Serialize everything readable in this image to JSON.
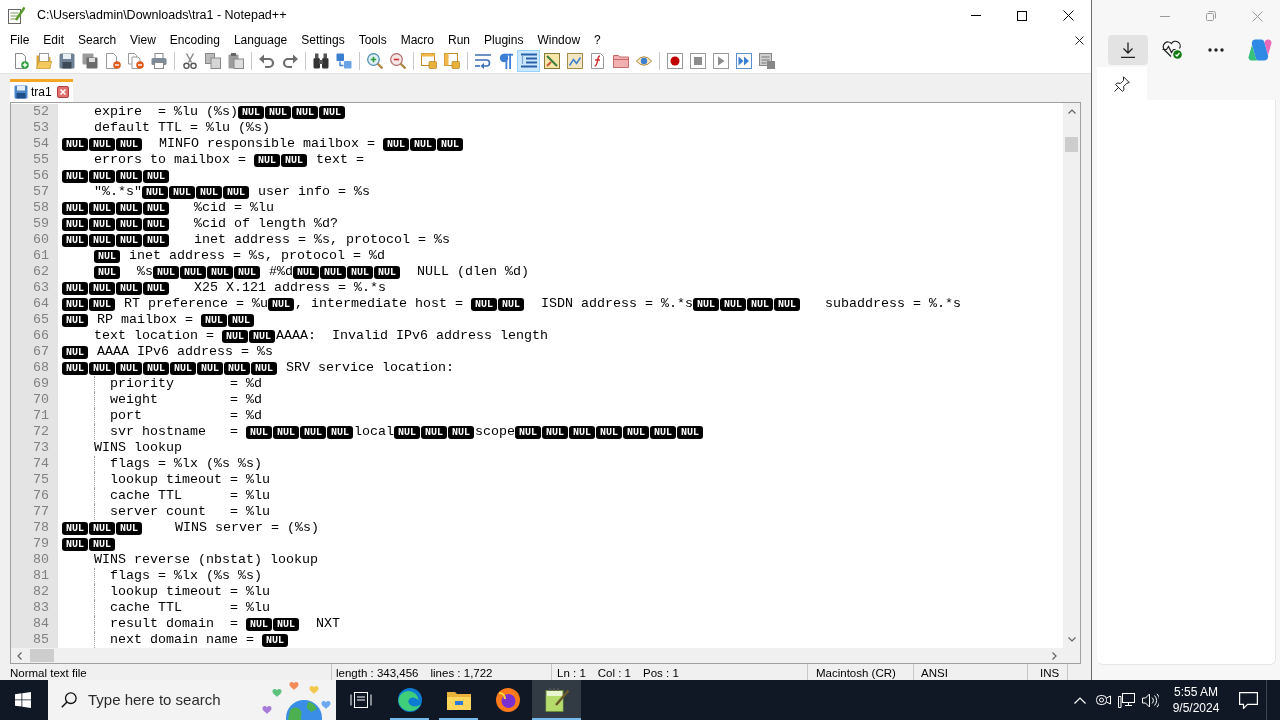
{
  "window": {
    "title": "C:\\Users\\admin\\Downloads\\tra1 - Notepad++"
  },
  "menu": [
    "File",
    "Edit",
    "Search",
    "View",
    "Encoding",
    "Language",
    "Settings",
    "Tools",
    "Macro",
    "Run",
    "Plugins",
    "Window",
    "?"
  ],
  "toolbar": [
    {
      "buttons": [
        {
          "kind": "new",
          "on": false
        },
        {
          "kind": "open",
          "on": false
        },
        {
          "kind": "save",
          "on": false
        },
        {
          "kind": "save-all",
          "on": false
        },
        {
          "kind": "close",
          "on": false
        },
        {
          "kind": "close-all",
          "on": false
        },
        {
          "kind": "print",
          "on": false
        }
      ]
    },
    {
      "buttons": [
        {
          "kind": "cut",
          "on": false
        },
        {
          "kind": "copy",
          "on": false
        },
        {
          "kind": "paste",
          "on": false
        }
      ]
    },
    {
      "buttons": [
        {
          "kind": "undo",
          "on": false
        },
        {
          "kind": "redo",
          "on": false
        }
      ]
    },
    {
      "buttons": [
        {
          "kind": "find",
          "on": false
        },
        {
          "kind": "replace",
          "on": false
        }
      ]
    },
    {
      "buttons": [
        {
          "kind": "zoom-in",
          "on": false
        },
        {
          "kind": "zoom-out",
          "on": false
        }
      ]
    },
    {
      "buttons": [
        {
          "kind": "sync-vertical",
          "on": false
        },
        {
          "kind": "sync-horizontal",
          "on": false
        }
      ]
    },
    {
      "buttons": [
        {
          "kind": "word-wrap",
          "on": false
        },
        {
          "kind": "show-all-chars",
          "on": false
        },
        {
          "kind": "indent-guide",
          "on": true
        },
        {
          "kind": "user-language",
          "on": false
        },
        {
          "kind": "document-map",
          "on": false
        },
        {
          "kind": "function-list",
          "on": false
        },
        {
          "kind": "folder-workspace",
          "on": false
        },
        {
          "kind": "monitoring",
          "on": false
        }
      ]
    },
    {
      "buttons": [
        {
          "kind": "record",
          "on": false
        },
        {
          "kind": "stop",
          "on": false
        },
        {
          "kind": "play",
          "on": false
        },
        {
          "kind": "run-multiple",
          "on": false
        },
        {
          "kind": "save-macro",
          "on": false
        }
      ]
    }
  ],
  "tabs": [
    {
      "label": "tra1",
      "selected": true
    }
  ],
  "editor": {
    "lines": [
      {
        "number": "52",
        "segments": [
          {
            "kind": "text",
            "text": "    expire  = %lu (%s)"
          },
          {
            "kind": "nul",
            "text": "NUL"
          },
          {
            "kind": "nul",
            "text": "NUL"
          },
          {
            "kind": "nul",
            "text": "NUL"
          },
          {
            "kind": "nul",
            "text": "NUL"
          }
        ]
      },
      {
        "number": "53",
        "segments": [
          {
            "kind": "text",
            "text": "    default TTL = %lu (%s)"
          }
        ]
      },
      {
        "number": "54",
        "segments": [
          {
            "kind": "nul",
            "text": "NUL"
          },
          {
            "kind": "nul",
            "text": "NUL"
          },
          {
            "kind": "nul",
            "text": "NUL"
          },
          {
            "kind": "text",
            "text": "  MINFO responsible mailbox = "
          },
          {
            "kind": "nul",
            "text": "NUL"
          },
          {
            "kind": "nul",
            "text": "NUL"
          },
          {
            "kind": "nul",
            "text": "NUL"
          }
        ]
      },
      {
        "number": "55",
        "segments": [
          {
            "kind": "text",
            "text": "    errors to mailbox = "
          },
          {
            "kind": "nul",
            "text": "NUL"
          },
          {
            "kind": "nul",
            "text": "NUL"
          },
          {
            "kind": "text",
            "text": " text ="
          }
        ]
      },
      {
        "number": "56",
        "segments": [
          {
            "kind": "nul",
            "text": "NUL"
          },
          {
            "kind": "nul",
            "text": "NUL"
          },
          {
            "kind": "nul",
            "text": "NUL"
          },
          {
            "kind": "nul",
            "text": "NUL"
          }
        ]
      },
      {
        "number": "57",
        "segments": [
          {
            "kind": "text",
            "text": "    \"%.*s\""
          },
          {
            "kind": "nul",
            "text": "NUL"
          },
          {
            "kind": "nul",
            "text": "NUL"
          },
          {
            "kind": "nul",
            "text": "NUL"
          },
          {
            "kind": "nul",
            "text": "NUL"
          },
          {
            "kind": "text",
            "text": " user info = %s"
          }
        ]
      },
      {
        "number": "58",
        "segments": [
          {
            "kind": "nul",
            "text": "NUL"
          },
          {
            "kind": "nul",
            "text": "NUL"
          },
          {
            "kind": "nul",
            "text": "NUL"
          },
          {
            "kind": "nul",
            "text": "NUL"
          },
          {
            "kind": "text",
            "text": "   %cid = %lu"
          }
        ]
      },
      {
        "number": "59",
        "segments": [
          {
            "kind": "nul",
            "text": "NUL"
          },
          {
            "kind": "nul",
            "text": "NUL"
          },
          {
            "kind": "nul",
            "text": "NUL"
          },
          {
            "kind": "nul",
            "text": "NUL"
          },
          {
            "kind": "text",
            "text": "   %cid of length %d?"
          }
        ]
      },
      {
        "number": "60",
        "segments": [
          {
            "kind": "nul",
            "text": "NUL"
          },
          {
            "kind": "nul",
            "text": "NUL"
          },
          {
            "kind": "nul",
            "text": "NUL"
          },
          {
            "kind": "nul",
            "text": "NUL"
          },
          {
            "kind": "text",
            "text": "   inet address = %s, protocol = %s"
          }
        ]
      },
      {
        "number": "61",
        "segments": [
          {
            "kind": "tab"
          },
          {
            "kind": "nul",
            "text": "NUL"
          },
          {
            "kind": "text",
            "text": " inet address = %s, protocol = %d"
          }
        ]
      },
      {
        "number": "62",
        "segments": [
          {
            "kind": "tab"
          },
          {
            "kind": "nul",
            "text": "NUL"
          },
          {
            "kind": "text",
            "text": "  %s"
          },
          {
            "kind": "nul",
            "text": "NUL"
          },
          {
            "kind": "nul",
            "text": "NUL"
          },
          {
            "kind": "nul",
            "text": "NUL"
          },
          {
            "kind": "nul",
            "text": "NUL"
          },
          {
            "kind": "text",
            "text": " #%d"
          },
          {
            "kind": "nul",
            "text": "NUL"
          },
          {
            "kind": "nul",
            "text": "NUL"
          },
          {
            "kind": "nul",
            "text": "NUL"
          },
          {
            "kind": "nul",
            "text": "NUL"
          },
          {
            "kind": "text",
            "text": "  NULL (dlen %d)"
          }
        ]
      },
      {
        "number": "63",
        "segments": [
          {
            "kind": "nul",
            "text": "NUL"
          },
          {
            "kind": "nul",
            "text": "NUL"
          },
          {
            "kind": "nul",
            "text": "NUL"
          },
          {
            "kind": "nul",
            "text": "NUL"
          },
          {
            "kind": "text",
            "text": "   X25 X.121 address = %.*s"
          }
        ]
      },
      {
        "number": "64",
        "segments": [
          {
            "kind": "nul",
            "text": "NUL"
          },
          {
            "kind": "nul",
            "text": "NUL"
          },
          {
            "kind": "text",
            "text": " RT preference = %u"
          },
          {
            "kind": "nul",
            "text": "NUL"
          },
          {
            "kind": "text",
            "text": ", intermediate host = "
          },
          {
            "kind": "nul",
            "text": "NUL"
          },
          {
            "kind": "nul",
            "text": "NUL"
          },
          {
            "kind": "text",
            "text": "  ISDN address = %.*s"
          },
          {
            "kind": "nul",
            "text": "NUL"
          },
          {
            "kind": "nul",
            "text": "NUL"
          },
          {
            "kind": "nul",
            "text": "NUL"
          },
          {
            "kind": "nul",
            "text": "NUL"
          },
          {
            "kind": "text",
            "text": "   subaddress = %.*s"
          }
        ]
      },
      {
        "number": "65",
        "segments": [
          {
            "kind": "nul",
            "text": "NUL"
          },
          {
            "kind": "text",
            "text": " RP mailbox = "
          },
          {
            "kind": "nul",
            "text": "NUL"
          },
          {
            "kind": "nul",
            "text": "NUL"
          }
        ]
      },
      {
        "number": "66",
        "segments": [
          {
            "kind": "text",
            "text": "    text location = "
          },
          {
            "kind": "nul",
            "text": "NUL"
          },
          {
            "kind": "nul",
            "text": "NUL"
          },
          {
            "kind": "text",
            "text": "AAAA:  Invalid IPv6 address length"
          }
        ]
      },
      {
        "number": "67",
        "segments": [
          {
            "kind": "nul",
            "text": "NUL"
          },
          {
            "kind": "text",
            "text": " AAAA IPv6 address = %s"
          }
        ]
      },
      {
        "number": "68",
        "segments": [
          {
            "kind": "nul",
            "text": "NUL"
          },
          {
            "kind": "nul",
            "text": "NUL"
          },
          {
            "kind": "nul",
            "text": "NUL"
          },
          {
            "kind": "nul",
            "text": "NUL"
          },
          {
            "kind": "nul",
            "text": "NUL"
          },
          {
            "kind": "nul",
            "text": "NUL"
          },
          {
            "kind": "nul",
            "text": "NUL"
          },
          {
            "kind": "nul",
            "text": "NUL"
          },
          {
            "kind": "text",
            "text": " SRV service location:"
          }
        ]
      },
      {
        "number": "69",
        "segments": [
          {
            "kind": "text",
            "text": "      priority       = %d"
          }
        ]
      },
      {
        "number": "70",
        "segments": [
          {
            "kind": "text",
            "text": "      weight         = %d"
          }
        ]
      },
      {
        "number": "71",
        "segments": [
          {
            "kind": "text",
            "text": "      port           = %d"
          }
        ]
      },
      {
        "number": "72",
        "segments": [
          {
            "kind": "text",
            "text": "      svr hostname   = "
          },
          {
            "kind": "nul",
            "text": "NUL"
          },
          {
            "kind": "nul",
            "text": "NUL"
          },
          {
            "kind": "nul",
            "text": "NUL"
          },
          {
            "kind": "nul",
            "text": "NUL"
          },
          {
            "kind": "text",
            "text": "local"
          },
          {
            "kind": "nul",
            "text": "NUL"
          },
          {
            "kind": "nul",
            "text": "NUL"
          },
          {
            "kind": "nul",
            "text": "NUL"
          },
          {
            "kind": "text",
            "text": "scope"
          },
          {
            "kind": "nul",
            "text": "NUL"
          },
          {
            "kind": "nul",
            "text": "NUL"
          },
          {
            "kind": "nul",
            "text": "NUL"
          },
          {
            "kind": "nul",
            "text": "NUL"
          },
          {
            "kind": "nul",
            "text": "NUL"
          },
          {
            "kind": "nul",
            "text": "NUL"
          },
          {
            "kind": "nul",
            "text": "NUL"
          }
        ]
      },
      {
        "number": "73",
        "segments": [
          {
            "kind": "text",
            "text": "    WINS lookup"
          }
        ]
      },
      {
        "number": "74",
        "segments": [
          {
            "kind": "text",
            "text": "      flags = %lx (%s %s)"
          }
        ]
      },
      {
        "number": "75",
        "segments": [
          {
            "kind": "text",
            "text": "      lookup timeout = %lu"
          }
        ]
      },
      {
        "number": "76",
        "segments": [
          {
            "kind": "text",
            "text": "      cache TTL      = %lu"
          }
        ]
      },
      {
        "number": "77",
        "segments": [
          {
            "kind": "text",
            "text": "      server count   = %lu"
          }
        ]
      },
      {
        "number": "78",
        "segments": [
          {
            "kind": "nul",
            "text": "NUL"
          },
          {
            "kind": "nul",
            "text": "NUL"
          },
          {
            "kind": "nul",
            "text": "NUL"
          },
          {
            "kind": "text",
            "text": "    WINS server = (%s)"
          }
        ]
      },
      {
        "number": "79",
        "segments": [
          {
            "kind": "nul",
            "text": "NUL"
          },
          {
            "kind": "nul",
            "text": "NUL"
          }
        ]
      },
      {
        "number": "80",
        "segments": [
          {
            "kind": "text",
            "text": "    WINS reverse (nbstat) lookup"
          }
        ]
      },
      {
        "number": "81",
        "segments": [
          {
            "kind": "text",
            "text": "      flags = %lx (%s %s)"
          }
        ]
      },
      {
        "number": "82",
        "segments": [
          {
            "kind": "text",
            "text": "      lookup timeout = %lu"
          }
        ]
      },
      {
        "number": "83",
        "segments": [
          {
            "kind": "text",
            "text": "      cache TTL      = %lu"
          }
        ]
      },
      {
        "number": "84",
        "segments": [
          {
            "kind": "text",
            "text": "      result domain  = "
          },
          {
            "kind": "nul",
            "text": "NUL"
          },
          {
            "kind": "nul",
            "text": "NUL"
          },
          {
            "kind": "text",
            "text": "  NXT"
          }
        ]
      },
      {
        "number": "85",
        "segments": [
          {
            "kind": "text",
            "text": "      next domain name = "
          },
          {
            "kind": "nul",
            "text": "NUL"
          }
        ]
      }
    ]
  },
  "status_bar": [
    {
      "items": [
        "Normal text file"
      ]
    },
    {
      "items": [
        "length : 343,456",
        "lines : 1,722"
      ]
    },
    {
      "items": [
        "Ln : 1",
        "Col : 1",
        "Pos : 1"
      ]
    },
    {
      "items": [
        "Macintosh (CR)"
      ]
    },
    {
      "items": [
        "ANSI"
      ]
    },
    {
      "items": [
        "INS"
      ]
    }
  ],
  "browser": {
    "toolbar": [
      {
        "kind": "downloads",
        "on": true
      },
      {
        "kind": "essentials",
        "on": false
      },
      {
        "kind": "more",
        "on": false
      },
      {
        "kind": "assistant",
        "on": false
      }
    ]
  },
  "taskbar": {
    "search": {
      "placeholder": "Type here to search"
    },
    "apps": [
      {
        "kind": "task-view",
        "running": false,
        "selected": false
      },
      {
        "kind": "edge",
        "running": true,
        "selected": false
      },
      {
        "kind": "file-explorer",
        "running": true,
        "selected": false
      },
      {
        "kind": "firefox",
        "running": false,
        "selected": false
      },
      {
        "kind": "notepad-plus-plus",
        "running": true,
        "selected": true
      }
    ],
    "clock": {
      "time": "5:55 AM",
      "date": "9/5/2024"
    }
  }
}
